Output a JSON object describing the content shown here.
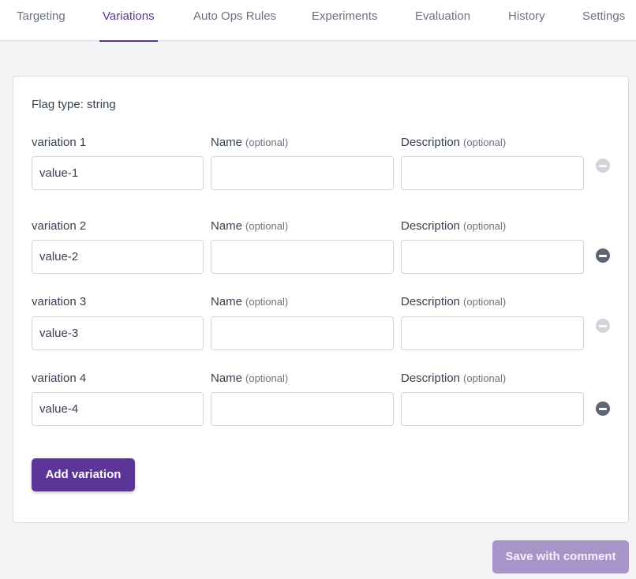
{
  "tabs": [
    {
      "label": "Targeting",
      "active": false
    },
    {
      "label": "Variations",
      "active": true
    },
    {
      "label": "Auto Ops Rules",
      "active": false
    },
    {
      "label": "Experiments",
      "active": false
    },
    {
      "label": "Evaluation",
      "active": false
    },
    {
      "label": "History",
      "active": false
    },
    {
      "label": "Settings",
      "active": false
    }
  ],
  "form": {
    "flag_type": "Flag type: string",
    "name_label": "Name",
    "description_label": "Description",
    "optional_label": "(optional)",
    "variations": [
      {
        "label": "variation 1",
        "value": "value-1",
        "name": "",
        "description": "",
        "remove_enabled": false
      },
      {
        "label": "variation 2",
        "value": "value-2",
        "name": "",
        "description": "",
        "remove_enabled": true
      },
      {
        "label": "variation 3",
        "value": "value-3",
        "name": "",
        "description": "",
        "remove_enabled": false
      },
      {
        "label": "variation 4",
        "value": "value-4",
        "name": "",
        "description": "",
        "remove_enabled": true
      }
    ],
    "add_variation_label": "Add variation"
  },
  "footer": {
    "save_label": "Save with comment"
  },
  "colors": {
    "accent": "#5b3597",
    "save_disabled": "#a894c8"
  }
}
